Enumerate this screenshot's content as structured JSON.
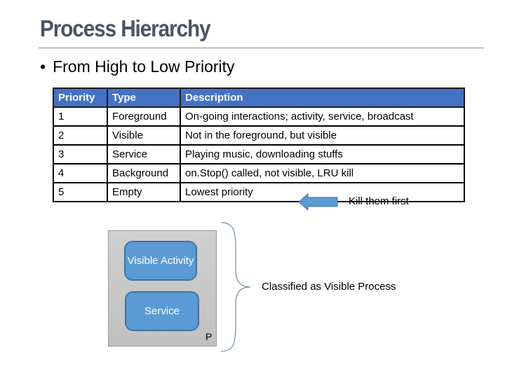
{
  "slide": {
    "title": "Process Hierarchy",
    "bullet": "From High to Low Priority",
    "bullet_marker": "•"
  },
  "table": {
    "headers": [
      "Priority",
      "Type",
      "Description"
    ],
    "header_color": "#4472c4",
    "rows": [
      {
        "priority": "1",
        "type": "Foreground",
        "description": "On-going interactions; activity, service, broadcast"
      },
      {
        "priority": "2",
        "type": "Visible",
        "description": "Not in the foreground, but visible"
      },
      {
        "priority": "3",
        "type": "Service",
        "description": "Playing music, downloading stuffs"
      },
      {
        "priority": "4",
        "type": "Background",
        "description": "on.Stop() called, not visible, LRU kill"
      },
      {
        "priority": "5",
        "type": "Empty",
        "description": "Lowest priority"
      }
    ],
    "annotation": {
      "icon": "left-arrow-icon",
      "label": "Kill them first",
      "color": "#5b9bd5"
    }
  },
  "diagram": {
    "process_label": "P",
    "components": [
      {
        "label": "Visible Activity"
      },
      {
        "label": "Service"
      }
    ],
    "component_color": "#5b9bd5",
    "brace_label": "Classified as Visible Process"
  }
}
